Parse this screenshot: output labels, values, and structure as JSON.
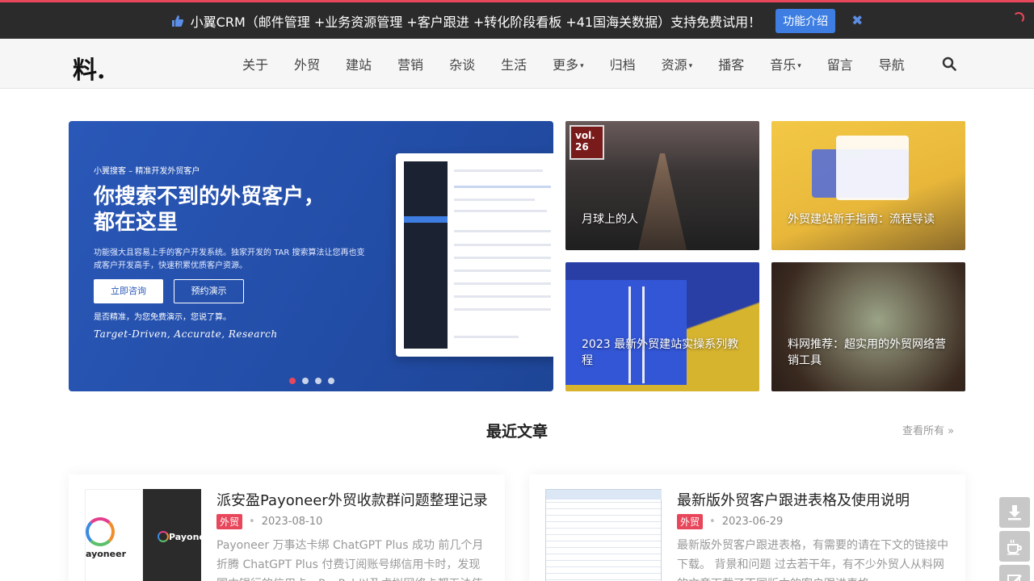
{
  "announcement": {
    "text": "小翼CRM（邮件管理 +业务资源管理 +客户跟进 +转化阶段看板 +41国海关数据）支持免费试用！",
    "button": "功能介绍",
    "close": "✖"
  },
  "nav": {
    "logo": "料.",
    "items": [
      "关于",
      "外贸",
      "建站",
      "营销",
      "杂谈",
      "生活",
      "更多",
      "归档",
      "资源",
      "播客",
      "音乐",
      "留言",
      "导航"
    ],
    "dropdown_caret": "▾"
  },
  "hero": {
    "brand": "小翼搜客 – 精准开发外贸客户",
    "headline_1": "你搜索不到的外贸客户，",
    "headline_2": "都在这里",
    "desc": "功能强大且容易上手的客户开发系统。独家开发的 TAR 搜索算法让您再也变成客户开发高手，快速积累优质客户资源。",
    "button_primary": "立即咨询",
    "button_secondary": "预约演示",
    "note": "是否精准，为您免费演示，您说了算。",
    "tagline": "Target-Driven, Accurate, Research",
    "slides": 4,
    "active_slide": 1
  },
  "tiles": [
    {
      "badge_line1": "vol.",
      "badge_line2": "26",
      "caption": "月球上的人"
    },
    {
      "caption": "外贸建站新手指南：流程导读"
    },
    {
      "caption": "2023 最新外贸建站实操系列教程"
    },
    {
      "caption": "料网推荐：超实用的外贸网络营销工具"
    }
  ],
  "section": {
    "title": "最近文章",
    "view_all": "查看所有 »"
  },
  "articles": [
    {
      "title": "派安盈Payoneer外贸收款群问题整理记录",
      "category": "外贸",
      "date": "2023-08-10",
      "excerpt": "Payoneer 万事达卡绑 ChatGPT Plus 成功 前几个月折腾 ChatGPT Plus 付费订阅账号绑信用卡时，发现国内银行的信用卡，PayPal 以及虚拟网络卡都无法使用",
      "thumb_text_left": "ayoneer",
      "thumb_text_right": "Payone"
    },
    {
      "title": "最新版外贸客户跟进表格及使用说明",
      "category": "外贸",
      "date": "2023-06-29",
      "excerpt": "最新版外贸客户跟进表格，有需要的请在下文的链接中下载。 背景和问题 过去若干年，有不少外贸人从料网的文章下载了不同版本的客户跟进表格"
    }
  ],
  "colors": {
    "accent": "#e8475b",
    "topbar_bg": "#2b2b2b",
    "hero_blue": "#2a58b8",
    "button_blue": "#3e7ee3"
  }
}
